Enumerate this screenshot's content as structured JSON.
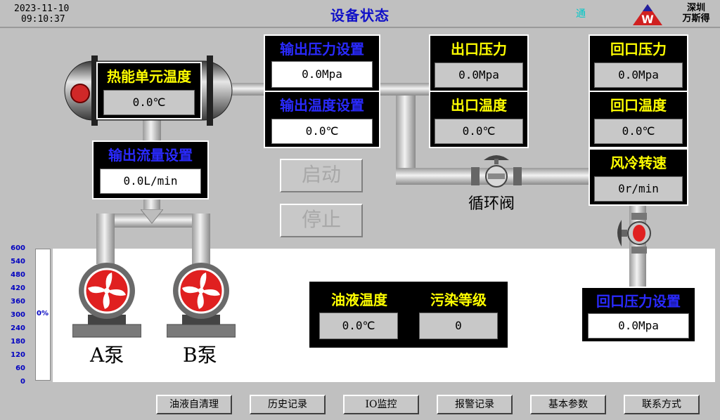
{
  "header": {
    "date": "2023-11-10",
    "time": "09:10:37",
    "title": "设备状态",
    "marker": "通",
    "company_line1": "深圳",
    "company_line2": "万斯得"
  },
  "heat_unit": {
    "label": "热能单元温度",
    "value": "0.0℃"
  },
  "output_flow_setting": {
    "label": "输出流量设置",
    "value": "0.0L/min"
  },
  "output_pressure_setting": {
    "label": "输出压力设置",
    "value": "0.0Mpa"
  },
  "output_temp_setting": {
    "label": "输出温度设置",
    "value": "0.0℃"
  },
  "outlet_pressure": {
    "label": "出口压力",
    "value": "0.0Mpa"
  },
  "outlet_temp": {
    "label": "出口温度",
    "value": "0.0℃"
  },
  "return_pressure": {
    "label": "回口压力",
    "value": "0.0Mpa"
  },
  "return_temp": {
    "label": "回口温度",
    "value": "0.0℃"
  },
  "fan_speed": {
    "label": "风冷转速",
    "value": "0r/min"
  },
  "return_pressure_setting": {
    "label": "回口压力设置",
    "value": "0.0Mpa"
  },
  "oil_temp": {
    "label": "油液温度",
    "value": "0.0℃"
  },
  "pollution_level": {
    "label": "污染等级",
    "value": "0"
  },
  "controls": {
    "start": "启动",
    "stop": "停止"
  },
  "valve_label": "循环阀",
  "pumps": {
    "a": "A泵",
    "b": "B泵"
  },
  "level_scale": {
    "ticks": [
      "600",
      "540",
      "480",
      "420",
      "360",
      "300",
      "240",
      "180",
      "120",
      "60",
      "0"
    ],
    "percent": "0%",
    "fill_fraction": 0
  },
  "nav": [
    "油液自清理",
    "历史记录",
    "IO监控",
    "报警记录",
    "基本参数",
    "联系方式"
  ],
  "colors": {
    "background": "#c0c0c0",
    "label_yellow": "#ffff00",
    "label_blue": "#2a2aff",
    "title_blue": "#1010c8",
    "pump_red": "#e02020"
  }
}
